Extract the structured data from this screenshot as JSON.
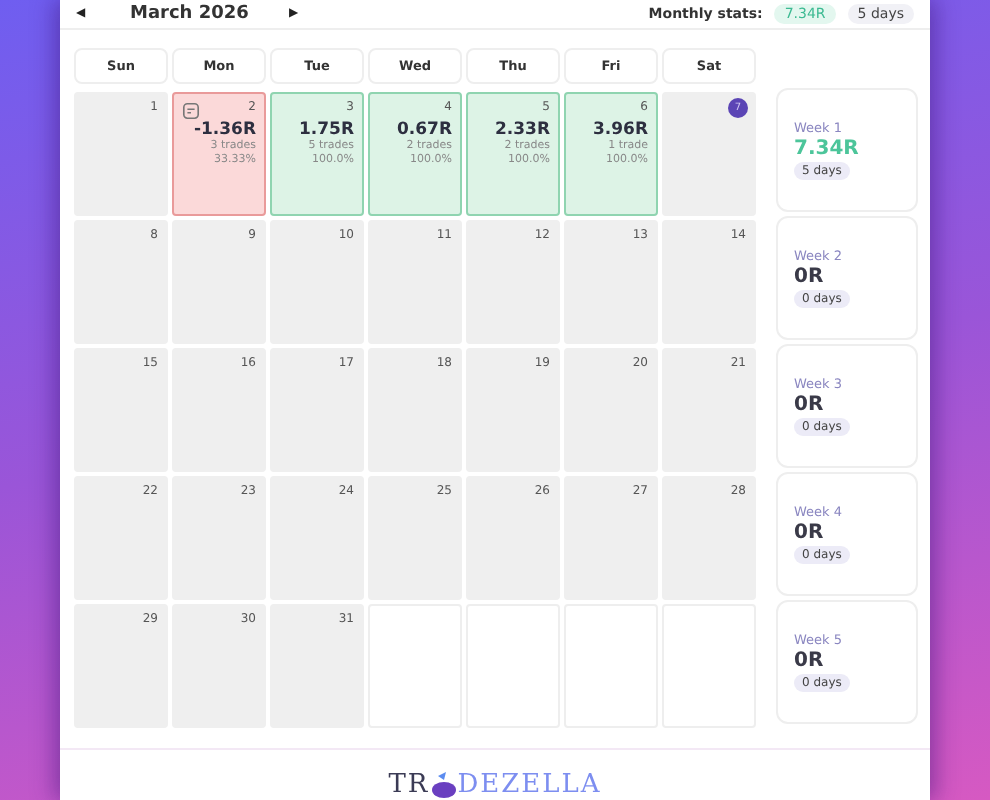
{
  "header": {
    "prev": "◀",
    "month": "March 2026",
    "next": "▶",
    "stats_label": "Monthly stats:",
    "stats_value": "7.34R",
    "stats_days": "5 days"
  },
  "weekdays": [
    "Sun",
    "Mon",
    "Tue",
    "Wed",
    "Thu",
    "Fri",
    "Sat"
  ],
  "weeks": [
    {
      "days": [
        {
          "kind": "plain",
          "date": "1"
        },
        {
          "kind": "loss",
          "date": "2",
          "note": true,
          "pnl": "-1.36R",
          "trades": "3 trades",
          "winrate": "33.33%"
        },
        {
          "kind": "win",
          "date": "3",
          "pnl": "1.75R",
          "trades": "5 trades",
          "winrate": "100.0%"
        },
        {
          "kind": "win",
          "date": "4",
          "pnl": "0.67R",
          "trades": "2 trades",
          "winrate": "100.0%"
        },
        {
          "kind": "win",
          "date": "5",
          "pnl": "2.33R",
          "trades": "2 trades",
          "winrate": "100.0%"
        },
        {
          "kind": "win",
          "date": "6",
          "pnl": "3.96R",
          "trades": "1 trade",
          "winrate": "100.0%"
        },
        {
          "kind": "plain",
          "date": "7",
          "today": true
        }
      ],
      "summary": {
        "label": "Week 1",
        "value": "7.34R",
        "positive": true,
        "days": "5 days"
      }
    },
    {
      "days": [
        {
          "kind": "plain",
          "date": "8"
        },
        {
          "kind": "plain",
          "date": "9"
        },
        {
          "kind": "plain",
          "date": "10"
        },
        {
          "kind": "plain",
          "date": "11"
        },
        {
          "kind": "plain",
          "date": "12"
        },
        {
          "kind": "plain",
          "date": "13"
        },
        {
          "kind": "plain",
          "date": "14"
        }
      ],
      "summary": {
        "label": "Week 2",
        "value": "0R",
        "positive": false,
        "days": "0 days"
      }
    },
    {
      "days": [
        {
          "kind": "plain",
          "date": "15"
        },
        {
          "kind": "plain",
          "date": "16"
        },
        {
          "kind": "plain",
          "date": "17"
        },
        {
          "kind": "plain",
          "date": "18"
        },
        {
          "kind": "plain",
          "date": "19"
        },
        {
          "kind": "plain",
          "date": "20"
        },
        {
          "kind": "plain",
          "date": "21"
        }
      ],
      "summary": {
        "label": "Week 3",
        "value": "0R",
        "positive": false,
        "days": "0 days"
      }
    },
    {
      "days": [
        {
          "kind": "plain",
          "date": "22"
        },
        {
          "kind": "plain",
          "date": "23"
        },
        {
          "kind": "plain",
          "date": "24"
        },
        {
          "kind": "plain",
          "date": "25"
        },
        {
          "kind": "plain",
          "date": "26"
        },
        {
          "kind": "plain",
          "date": "27"
        },
        {
          "kind": "plain",
          "date": "28"
        }
      ],
      "summary": {
        "label": "Week 4",
        "value": "0R",
        "positive": false,
        "days": "0 days"
      }
    },
    {
      "days": [
        {
          "kind": "plain",
          "date": "29"
        },
        {
          "kind": "plain",
          "date": "30"
        },
        {
          "kind": "plain",
          "date": "31"
        },
        {
          "kind": "empty"
        },
        {
          "kind": "empty"
        },
        {
          "kind": "empty"
        },
        {
          "kind": "empty"
        }
      ],
      "summary": {
        "label": "Week 5",
        "value": "0R",
        "positive": false,
        "days": "0 days"
      }
    }
  ],
  "logo": {
    "left": "TR",
    "right": "DEZELLA"
  }
}
